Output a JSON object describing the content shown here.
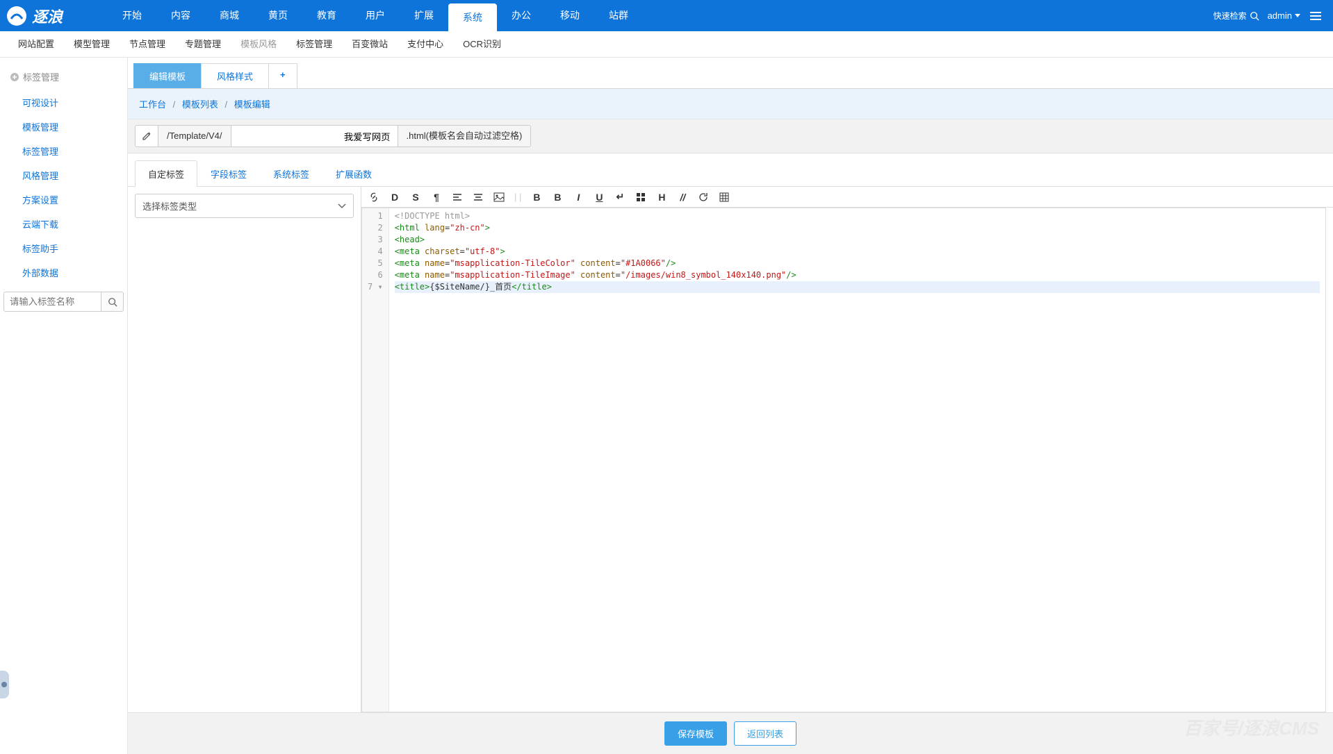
{
  "header": {
    "logo_text": "逐浪",
    "quick_search": "快速检索",
    "user": "admin",
    "nav": [
      "开始",
      "内容",
      "商城",
      "黄页",
      "教育",
      "用户",
      "扩展",
      "系统",
      "办公",
      "移动",
      "站群"
    ],
    "nav_active": 7
  },
  "subnav": {
    "items": [
      "网站配置",
      "模型管理",
      "节点管理",
      "专题管理",
      "模板风格",
      "标签管理",
      "百变微站",
      "支付中心",
      "OCR识别"
    ],
    "active": 4
  },
  "sidebar": {
    "title": "标签管理",
    "items": [
      "可视设计",
      "模板管理",
      "标签管理",
      "风格管理",
      "方案设置",
      "云端下载",
      "标签助手",
      "外部数据"
    ],
    "search_placeholder": "请输入标签名称"
  },
  "tabs": {
    "items": [
      "编辑模板",
      "风格样式"
    ],
    "active": 0
  },
  "breadcrumb": {
    "root": "工作台",
    "mid": "模板列表",
    "leaf": "模板编辑"
  },
  "path": {
    "prefix": "/Template/V4/",
    "value": "我爱写网页",
    "suffix": ".html(模板名会自动过滤空格)"
  },
  "inner_tabs": {
    "items": [
      "自定标签",
      "字段标签",
      "系统标签",
      "扩展函数"
    ],
    "active": 0
  },
  "select": {
    "placeholder": "选择标签类型"
  },
  "footer": {
    "save": "保存模板",
    "back": "返回列表"
  },
  "watermark": "百家号/逐浪CMS",
  "code": {
    "lines": [
      {
        "n": "1",
        "html": "<span class='t-doctype'>&lt;!DOCTYPE html&gt;</span>"
      },
      {
        "n": "2",
        "html": "<span class='t-tag'>&lt;html</span> <span class='t-attr'>lang</span>=<span class='t-str'>\"zh-cn\"</span><span class='t-tag'>&gt;</span>"
      },
      {
        "n": "3",
        "html": "<span class='t-tag'>&lt;head&gt;</span>"
      },
      {
        "n": "4",
        "html": "<span class='t-tag'>&lt;meta</span> <span class='t-attr'>charset</span>=<span class='t-str'>\"utf-8\"</span><span class='t-tag'>&gt;</span>"
      },
      {
        "n": "5",
        "html": "<span class='t-tag'>&lt;meta</span> <span class='t-attr'>name</span>=<span class='t-str'>\"msapplication-TileColor\"</span> <span class='t-attr'>content</span>=<span class='t-str'>\"#1A0066\"</span><span class='t-tag'>/&gt;</span>"
      },
      {
        "n": "6",
        "html": "<span class='t-tag'>&lt;meta</span> <span class='t-attr'>name</span>=<span class='t-str'>\"msapplication-TileImage\"</span> <span class='t-attr'>content</span>=<span class='t-str'>\"/images/win8_symbol_140x140.png\"</span><span class='t-tag'>/&gt;</span>"
      },
      {
        "n": "7 ▾",
        "html": "<span class='t-tag'>&lt;title&gt;</span>{$SiteName/}_首页<span class='t-tag'>&lt;/title&gt;</span>",
        "hl": true
      }
    ]
  }
}
